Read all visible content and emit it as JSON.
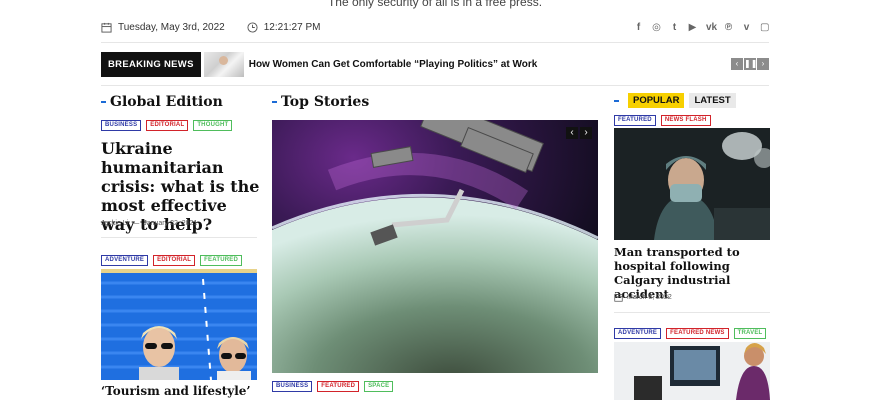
{
  "tagline": "The only security of all is in a free press.",
  "topbar": {
    "date": "Tuesday, May 3rd, 2022",
    "time": "12:21:27 PM",
    "social": [
      "f",
      "◎",
      "t",
      "▶",
      "vk",
      "℗",
      "v",
      "▢"
    ]
  },
  "breaking": {
    "label": "BREAKING NEWS",
    "title": "How Women Can Get Comfortable “Playing Politics” at Work",
    "prev": "‹",
    "pause": "❚❚",
    "next": "›"
  },
  "left": {
    "heading": "Global Edition",
    "article1": {
      "tags": [
        "BUSINESS",
        "EDITORIAL",
        "THOUGHT"
      ],
      "title": "Ukraine humanitarian crisis: what is the most effective way to help?",
      "author": "Jackie Li",
      "date": "January 22, 2021"
    },
    "article2": {
      "tags": [
        "ADVENTURE",
        "EDITORIAL",
        "FEATURED"
      ],
      "title": "‘Tourism and lifestyle’"
    }
  },
  "center": {
    "heading": "Top Stories",
    "nav_prev": "‹",
    "nav_next": "›",
    "tags": [
      "BUSINESS",
      "FEATURED",
      "SPACE"
    ]
  },
  "right": {
    "tab_popular": "POPULAR",
    "tab_latest": "LATEST",
    "article1": {
      "tags": [
        "FEATURED",
        "NEWS FLASH"
      ],
      "title": "Man transported to hospital following Calgary industrial accident",
      "date": "March 8, 2022"
    },
    "article2": {
      "tags": [
        "ADVENTURE",
        "FEATURED NEWS",
        "TRAVEL"
      ]
    }
  }
}
